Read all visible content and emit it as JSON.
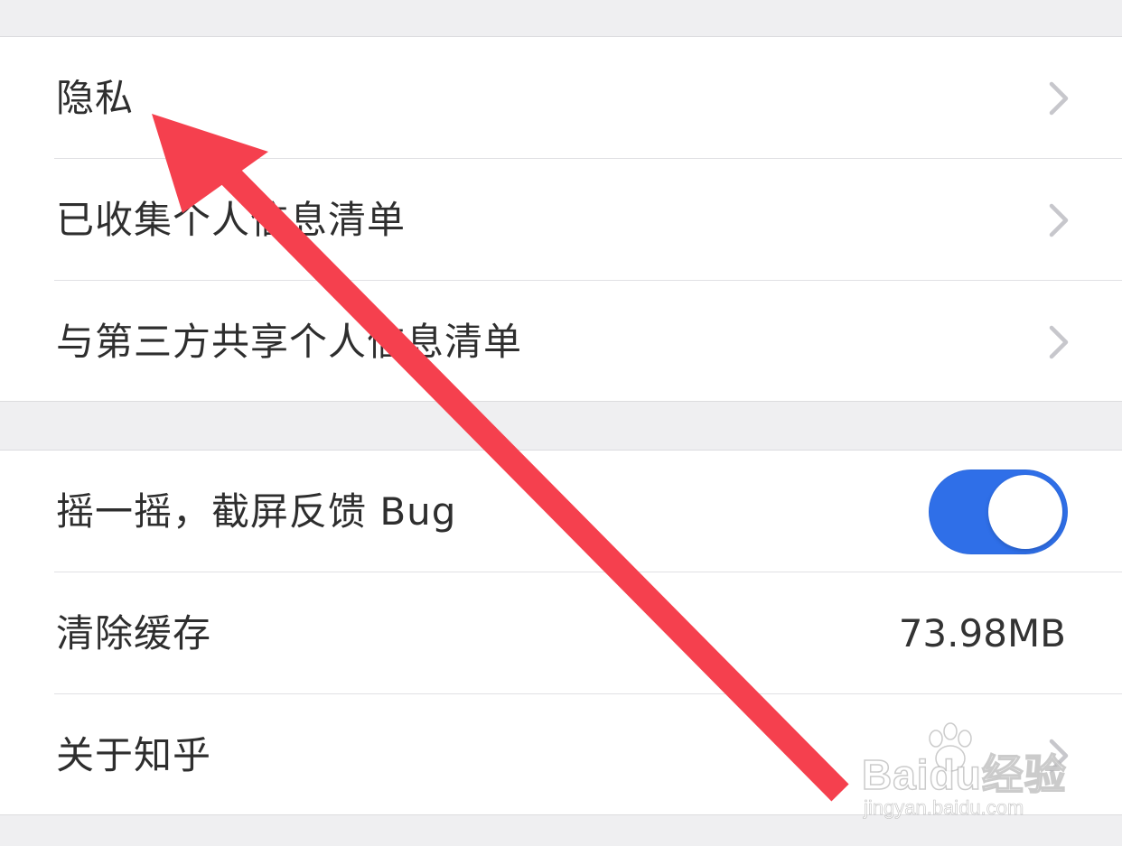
{
  "section_privacy": {
    "items": [
      {
        "label": "隐私",
        "icon": "chevron-right-icon"
      },
      {
        "label": "已收集个人信息清单",
        "icon": "chevron-right-icon"
      },
      {
        "label": "与第三方共享个人信息清单",
        "icon": "chevron-right-icon"
      }
    ]
  },
  "section_general": {
    "shake_feedback": {
      "label": "摇一摇，截屏反馈 Bug",
      "enabled": true
    },
    "clear_cache": {
      "label": "清除缓存",
      "value": "73.98MB"
    },
    "about": {
      "label": "关于知乎",
      "icon": "chevron-right-icon"
    }
  },
  "colors": {
    "toggle_on": "#2f6fe8",
    "annotation_arrow": "#f5404e",
    "background": "#efeff1"
  },
  "watermark": {
    "brand": "Baidu经验",
    "url": "jingyan.baidu.com"
  }
}
